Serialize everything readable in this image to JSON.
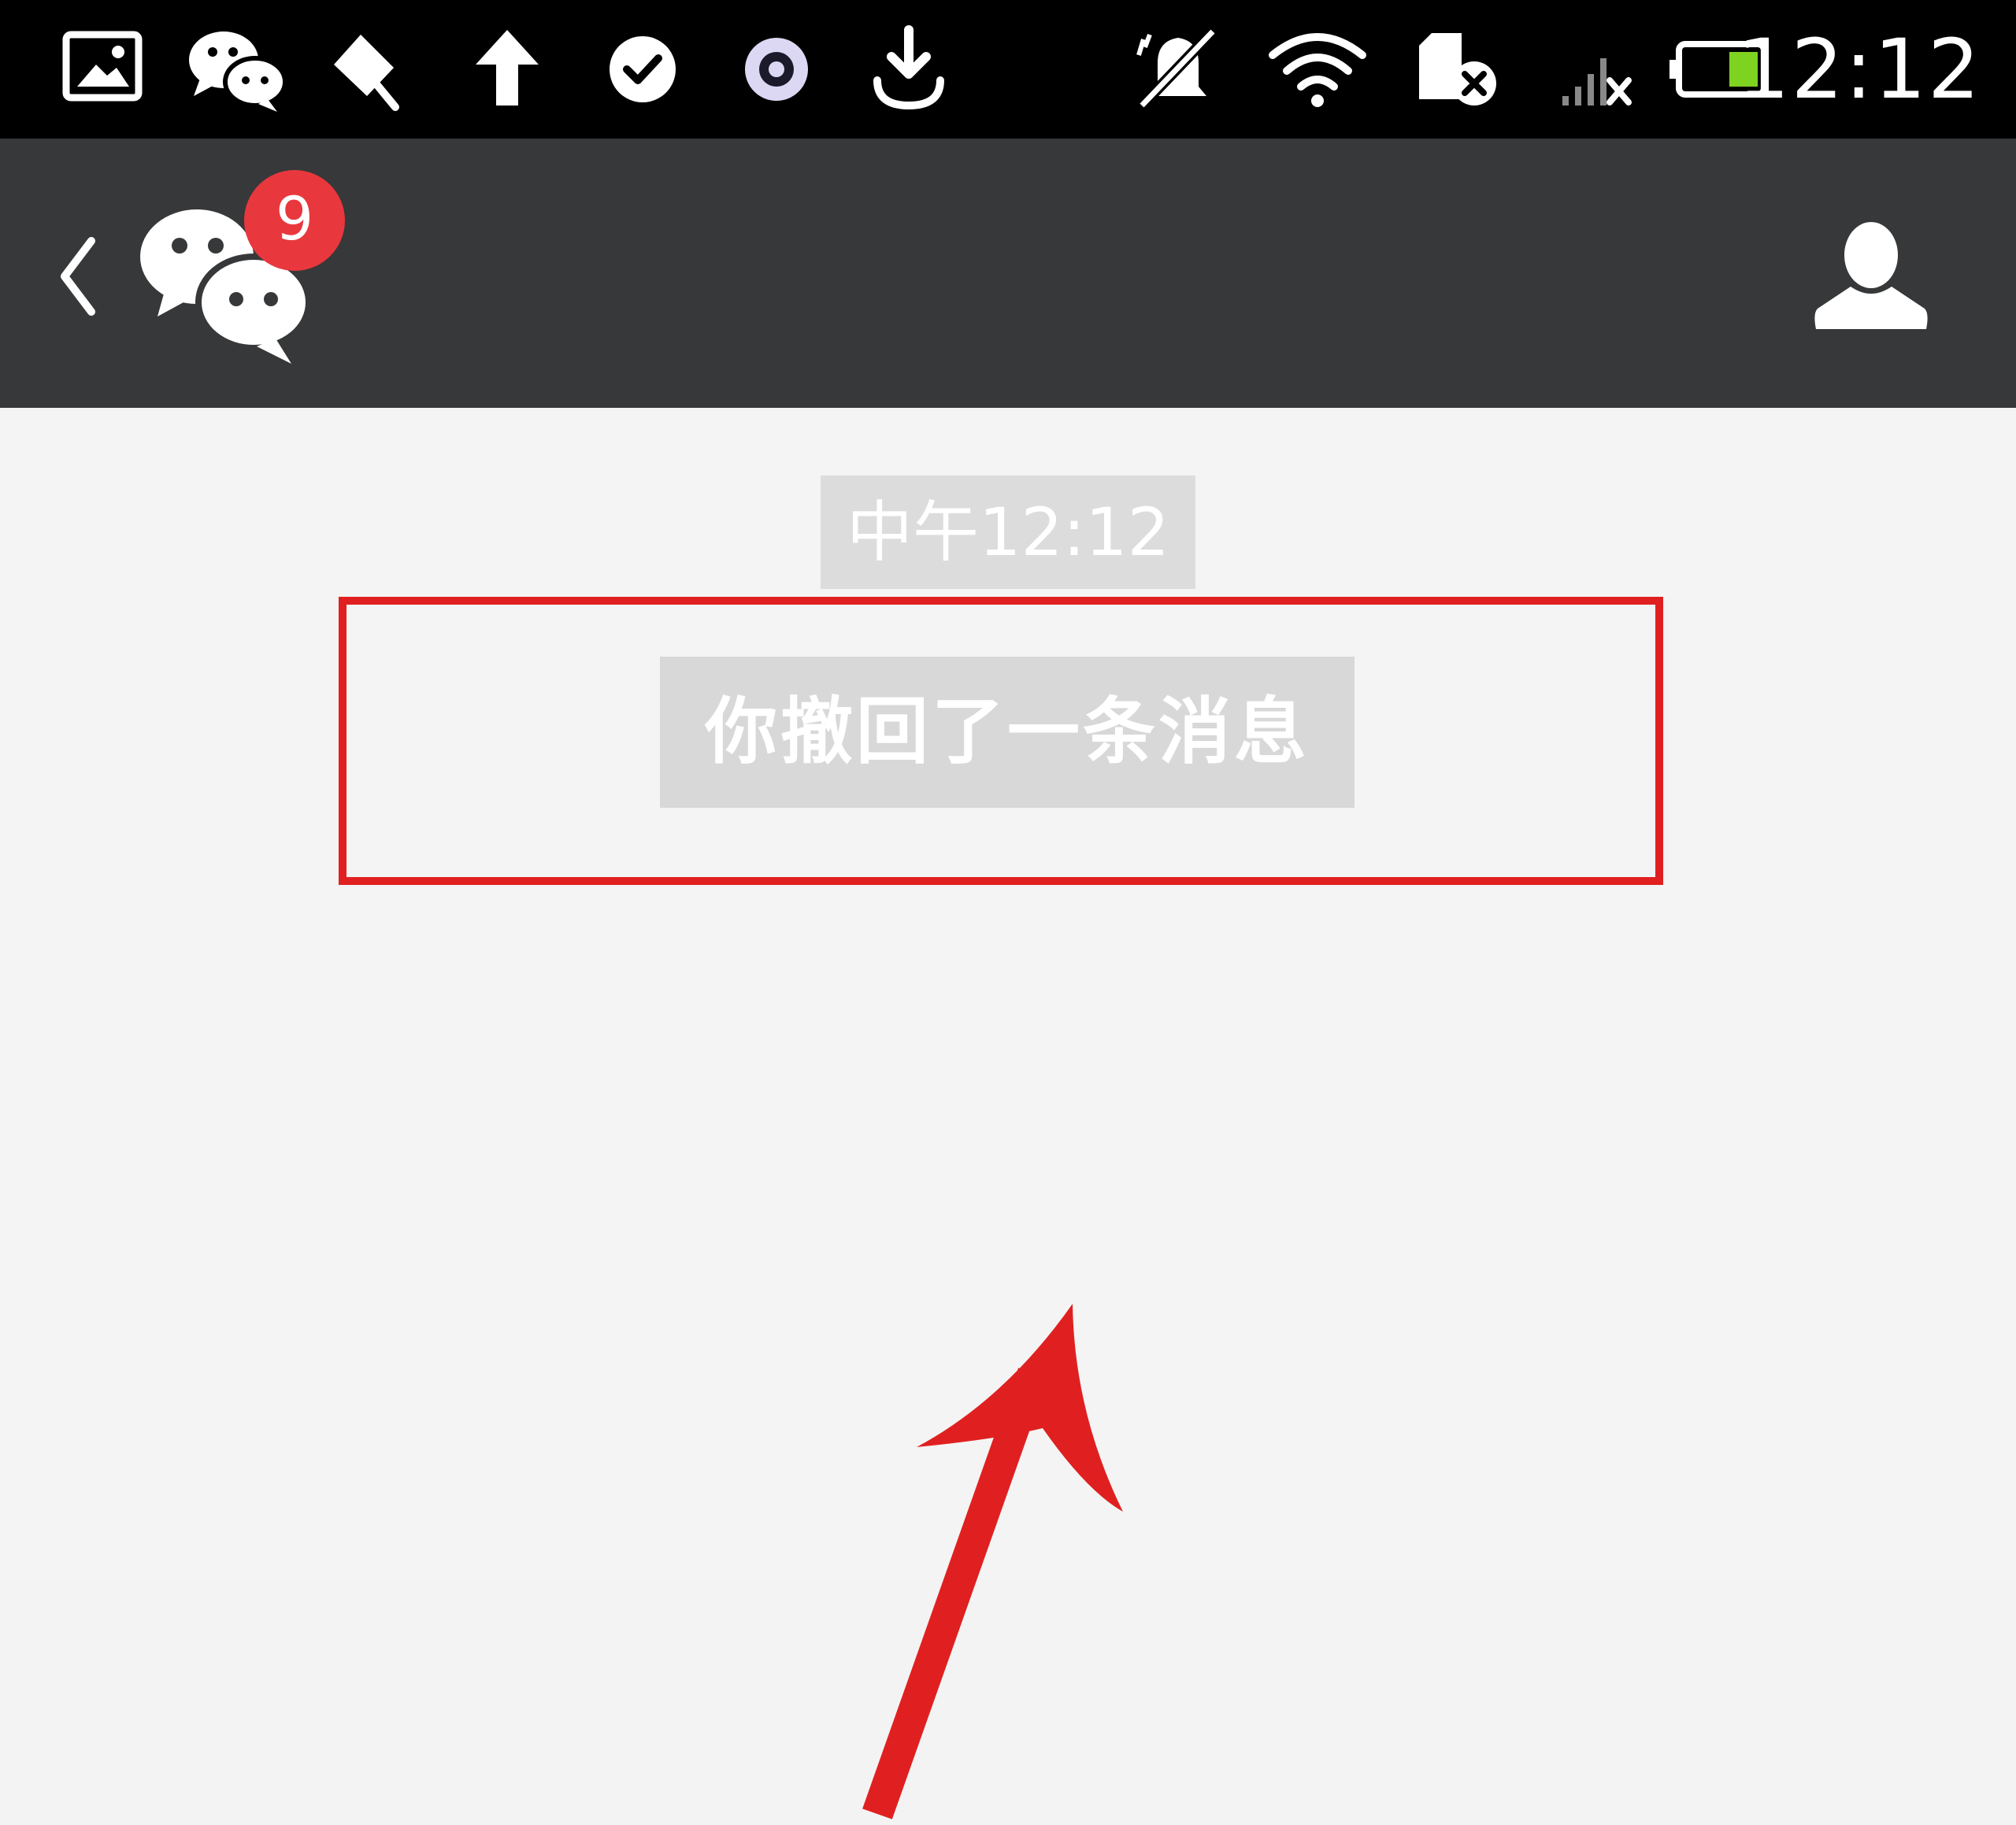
{
  "status_bar": {
    "time": "12:12",
    "icons": [
      "gallery-notification-icon",
      "wechat-notification-icon",
      "pin-notification-icon",
      "upload-icon",
      "check-circle-icon",
      "circle-app-icon",
      "download-icon",
      "mute-icon",
      "wifi-icon",
      "no-sim-icon",
      "signal-icon",
      "battery-icon"
    ]
  },
  "title_bar": {
    "unread_badge": "9",
    "back_icon": "chevron-left-icon",
    "chats_icon": "wechat-icon",
    "profile_icon": "person-icon"
  },
  "chat": {
    "timestamp": "中午12:12",
    "system_message": "你撤回了一条消息"
  },
  "annotation": {
    "color": "#e02020",
    "type": "highlight-box-with-arrow"
  },
  "colors": {
    "status_bar_bg": "#000000",
    "title_bar_bg": "#373839",
    "chat_bg": "#f4f4f4",
    "badge_red": "#e8383d",
    "battery_green": "#7ed321"
  }
}
